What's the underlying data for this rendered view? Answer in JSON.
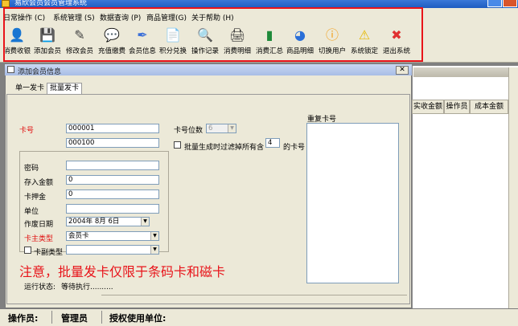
{
  "window": {
    "title": "易欣会员会员管理系统"
  },
  "menu": [
    "日常操作 (C)",
    "系统管理 (S)",
    "数据查询 (P)",
    "商品管理(G)",
    "关于帮助 (H)"
  ],
  "toolbar": [
    {
      "label": "消费收银",
      "icon": "cashier-icon",
      "glyph": "👤",
      "color": "#c0392b"
    },
    {
      "label": "添加会员",
      "icon": "add-member-icon",
      "glyph": "💾",
      "color": "#2a6b2a"
    },
    {
      "label": "修改会员",
      "icon": "edit-member-icon",
      "glyph": "✎",
      "color": "#444444"
    },
    {
      "label": "充值缴费",
      "icon": "recharge-icon",
      "glyph": "💬",
      "color": "#2e9e3e"
    },
    {
      "label": "会员信息",
      "icon": "member-info-icon",
      "glyph": "✒",
      "color": "#3a6fd8"
    },
    {
      "label": "积分兑换",
      "icon": "points-icon",
      "glyph": "📄",
      "color": "#3a6fd8"
    },
    {
      "label": "操作记录",
      "icon": "search-icon",
      "glyph": "🔍",
      "color": "#2a5fb0"
    },
    {
      "label": "消费明细",
      "icon": "printer-icon",
      "glyph": "🖨",
      "color": "#333333"
    },
    {
      "label": "消费汇总",
      "icon": "bar-summary-icon",
      "glyph": "▮",
      "color": "#1f8a3a"
    },
    {
      "label": "商品明细",
      "icon": "pie-chart-icon",
      "glyph": "◕",
      "color": "#2a6fd8"
    },
    {
      "label": "切换用户",
      "icon": "info-switch-icon",
      "glyph": "ⓘ",
      "color": "#f39c12"
    },
    {
      "label": "系统锁定",
      "icon": "warning-icon",
      "glyph": "⚠",
      "color": "#e6b800"
    },
    {
      "label": "退出系统",
      "icon": "exit-icon",
      "glyph": "✖",
      "color": "#e03030"
    }
  ],
  "background_table": {
    "headers": [
      "实收金额",
      "操作员",
      "成本金额"
    ]
  },
  "dialog": {
    "title": "添加会员信息",
    "tabs": [
      "单一发卡",
      "批量发卡"
    ],
    "card_no_label": "卡号",
    "card_no_from": "000001",
    "card_no_to": "000100",
    "card_digits_label": "卡号位数",
    "card_digits_value": "6",
    "filter_checkbox_label": "批量生成时过滤掉所有含",
    "filter_digit": "4",
    "filter_suffix": "的卡号",
    "dup_label": "重复卡号",
    "password_label": "密码",
    "password_value": "",
    "deposit_label": "存入金额",
    "deposit_value": "0",
    "pledge_label": "卡押金",
    "pledge_value": "0",
    "unit_label": "单位",
    "unit_value": "",
    "expire_label": "作废日期",
    "expire_value": "2004年 8月 6日",
    "card_type_label": "卡主类型",
    "card_type_value": "会员卡",
    "sub_type_label": "卡副类型",
    "sub_type_value": "",
    "note": "注意，批量发卡仅限于条码卡和磁卡",
    "run_status_label": "运行状态:",
    "run_status_value": "等待执行.........."
  },
  "status_bar": {
    "operator_label": "操作员:",
    "operator_value": "管理员",
    "license_label": "授权使用单位:"
  },
  "colors": {
    "annotation_red": "#e8141a",
    "label_red": "#e01010"
  }
}
